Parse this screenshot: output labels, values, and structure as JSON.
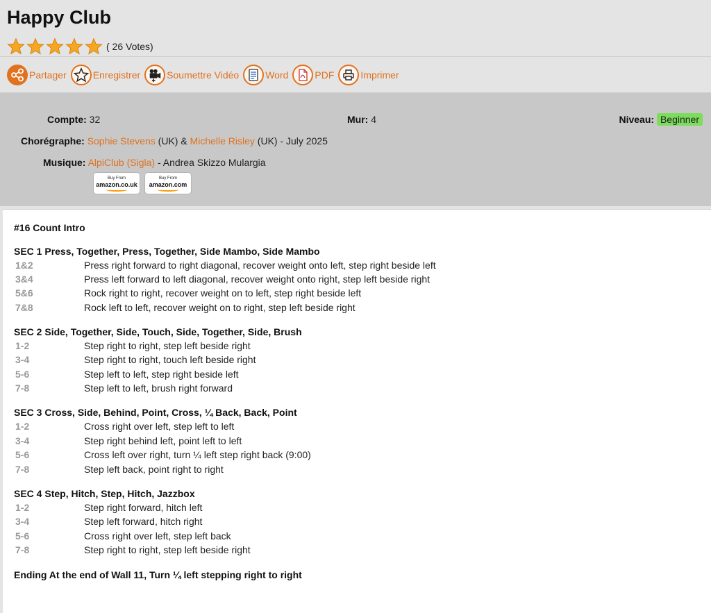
{
  "title": "Happy Club",
  "rating": {
    "stars": 5,
    "votes_text": "( 26 Votes)"
  },
  "toolbar": [
    {
      "label": "Partager",
      "icon": "share-icon"
    },
    {
      "label": "Enregistrer",
      "icon": "star-outline-icon"
    },
    {
      "label": "Soumettre Vidéo",
      "icon": "video-camera-icon"
    },
    {
      "label": "Word",
      "icon": "word-document-icon"
    },
    {
      "label": "PDF",
      "icon": "pdf-document-icon"
    },
    {
      "label": "Imprimer",
      "icon": "printer-icon"
    }
  ],
  "info": {
    "compte_label": "Compte:",
    "compte_value": "32",
    "mur_label": "Mur:",
    "mur_value": "4",
    "niveau_label": "Niveau:",
    "niveau_value": "Beginner",
    "choreo_label": "Chorégraphe:",
    "choreo1": "Sophie Stevens",
    "choreo1_country": " (UK) & ",
    "choreo2": "Michelle Risley",
    "choreo2_suffix": " (UK) - July 2025",
    "musique_label": "Musique:",
    "music_title": "AlpiClub (Sigla)",
    "music_artist": " - Andrea Skizzo Mulargia",
    "amazon_uk": {
      "top": "Buy From",
      "brand": "amazon.co.uk"
    },
    "amazon_com": {
      "top": "Buy From",
      "brand": "amazon.com"
    }
  },
  "sheet": {
    "intro": "#16 Count Intro",
    "sections": [
      {
        "title": "SEC 1 Press, Together, Press, Together, Side Mambo, Side Mambo",
        "steps": [
          {
            "count": "1&2",
            "text": "Press right forward to right diagonal, recover weight onto left, step right beside left"
          },
          {
            "count": "3&4",
            "text": "Press left forward to left diagonal, recover weight onto right, step left beside right"
          },
          {
            "count": "5&6",
            "text": "Rock right to right, recover weight on to left, step right beside left"
          },
          {
            "count": "7&8",
            "text": "Rock left to left, recover weight on to right, step left beside right"
          }
        ]
      },
      {
        "title": "SEC 2 Side, Together, Side, Touch, Side, Together, Side, Brush",
        "steps": [
          {
            "count": "1-2",
            "text": "Step right to right, step left beside right"
          },
          {
            "count": "3-4",
            "text": "Step right to right, touch left beside right"
          },
          {
            "count": "5-6",
            "text": "Step left to left, step right beside left"
          },
          {
            "count": "7-8",
            "text": "Step left to left, brush right forward"
          }
        ]
      },
      {
        "title": "SEC 3 Cross, Side, Behind, Point, Cross, ¼ Back, Back, Point",
        "steps": [
          {
            "count": "1-2",
            "text": "Cross right over left, step left to left"
          },
          {
            "count": "3-4",
            "text": "Step right behind left, point left to left"
          },
          {
            "count": "5-6",
            "text": "Cross left over right, turn ¼ left step right back (9:00)"
          },
          {
            "count": "7-8",
            "text": "Step left back, point right to right"
          }
        ]
      },
      {
        "title": "SEC 4 Step, Hitch, Step, Hitch, Jazzbox",
        "steps": [
          {
            "count": "1-2",
            "text": "Step right forward, hitch left"
          },
          {
            "count": "3-4",
            "text": "Step left forward, hitch right"
          },
          {
            "count": "5-6",
            "text": "Cross right over left, step left back"
          },
          {
            "count": "7-8",
            "text": "Step right to right, step left beside right"
          }
        ]
      }
    ],
    "ending": "Ending At the end of Wall 11, Turn ¼ left stepping right to right"
  }
}
